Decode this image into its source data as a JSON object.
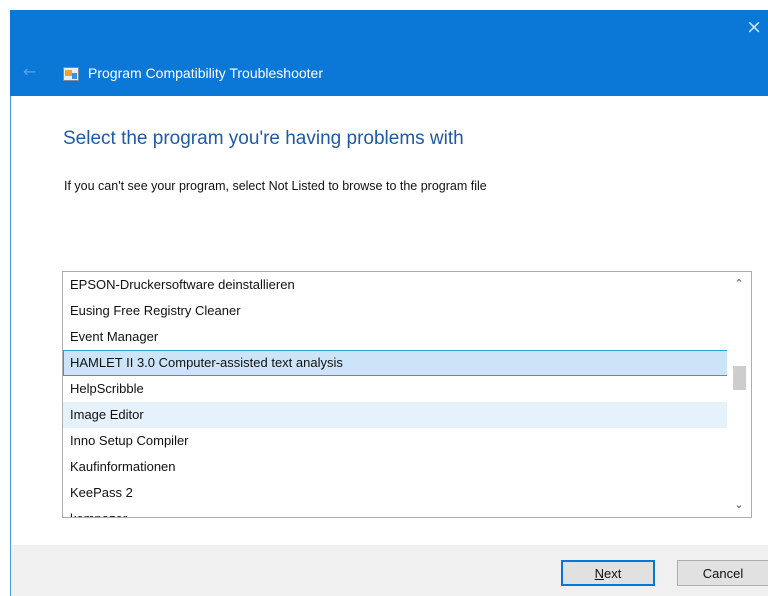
{
  "window": {
    "title": "Program Compatibility Troubleshooter",
    "close_glyph": "×",
    "back_glyph": "←",
    "titlebar_color": "#0b78d7"
  },
  "icons": {
    "close": "close-icon",
    "back": "back-arrow-icon",
    "app": "troubleshooter-app-icon",
    "scroll_up": "chevron-up-icon",
    "scroll_down": "chevron-down-icon"
  },
  "content": {
    "heading": "Select the program you're having problems with",
    "instruction": "If you can't see your program, select Not Listed to browse to the program file"
  },
  "program_list": {
    "items": [
      "EPSON-Druckersoftware deinstallieren",
      "Eusing Free Registry Cleaner",
      "Event Manager",
      "HAMLET II 3.0 Computer-assisted text analysis",
      "HelpScribble",
      "Image Editor",
      "Inno Setup Compiler",
      "Kaufinformationen",
      "KeePass 2",
      "kompozer"
    ],
    "selected_index": 3,
    "hovered_index": 5,
    "scroll_up_glyph": "⌃",
    "scroll_down_glyph": "⌄"
  },
  "buttons": {
    "next_mnemonic": "N",
    "next_rest": "ext",
    "cancel": "Cancel"
  },
  "colors": {
    "accent": "#0078d7",
    "heading": "#1e5aa6",
    "selection": "#cce4f7",
    "hover": "#e5f1fb"
  }
}
